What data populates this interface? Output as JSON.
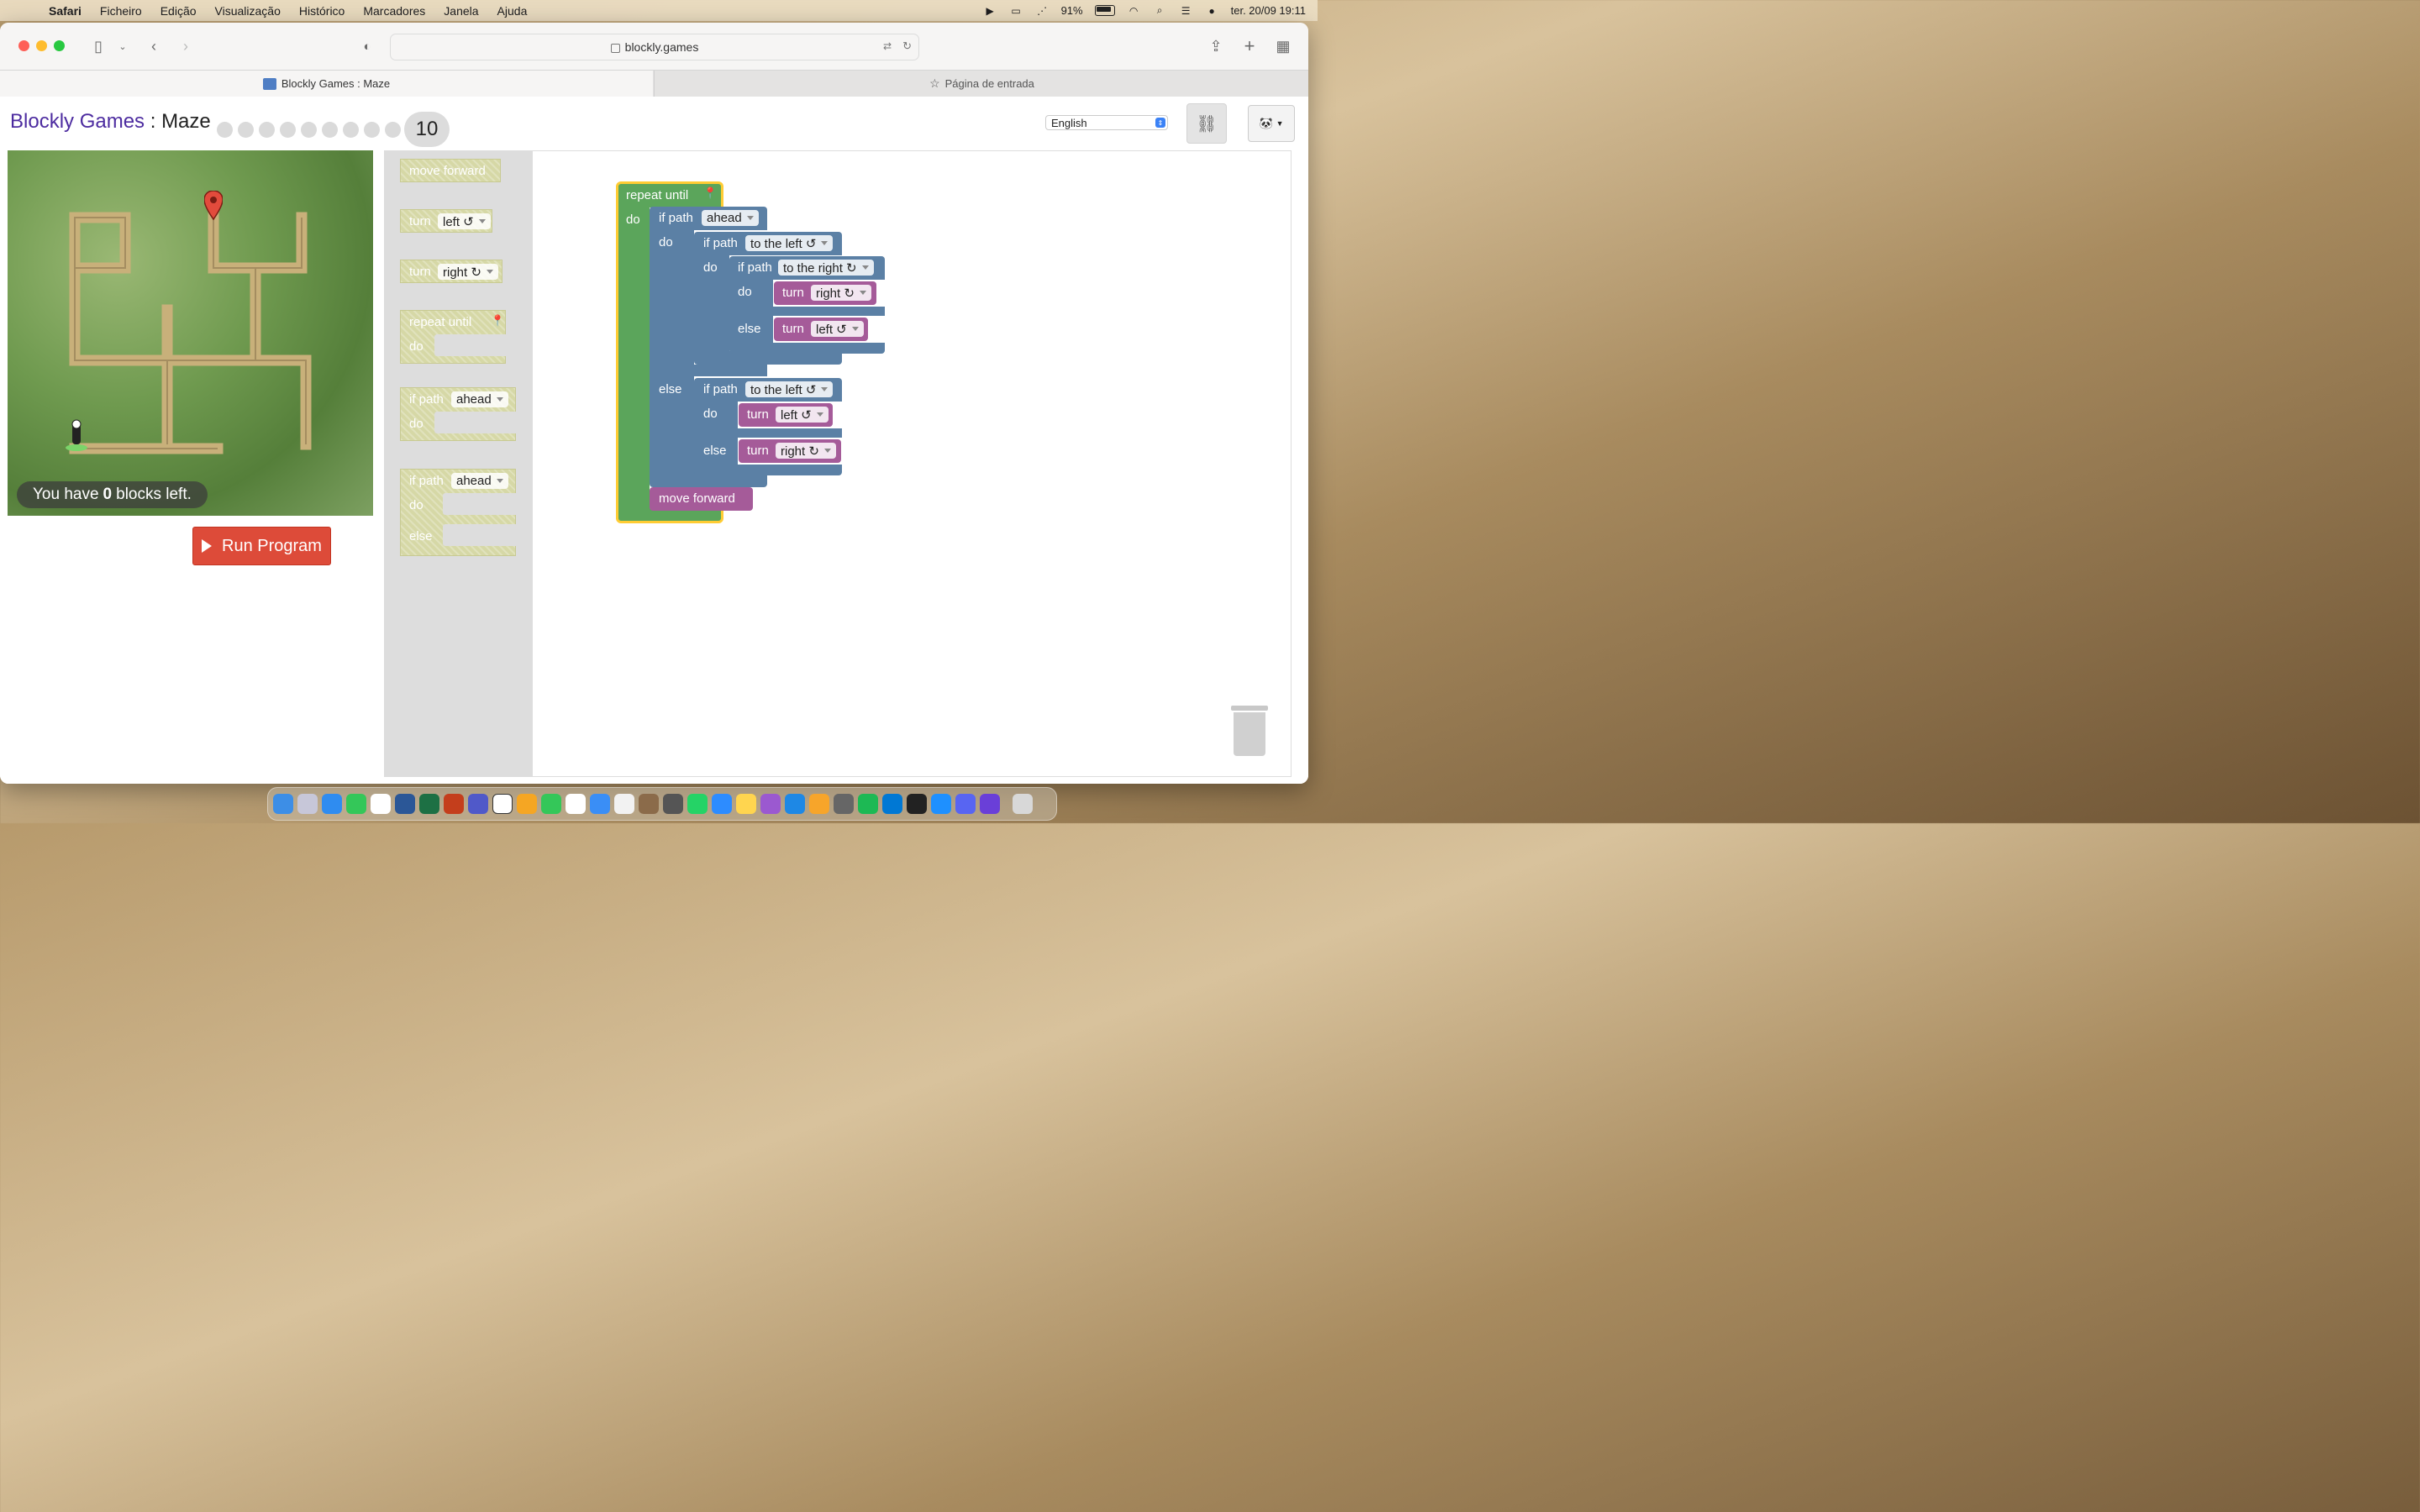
{
  "menubar": {
    "items": [
      "Safari",
      "Ficheiro",
      "Edição",
      "Visualização",
      "Histórico",
      "Marcadores",
      "Janela",
      "Ajuda"
    ],
    "battery": "91%",
    "datetime": "ter. 20/09  19:11"
  },
  "browser": {
    "url": "blockly.games",
    "tabs": [
      {
        "label": "Blockly Games : Maze",
        "active": true
      },
      {
        "label": "Página de entrada",
        "active": false
      }
    ]
  },
  "page": {
    "title_link": "Blockly Games",
    "title_sep": " : ",
    "title_game": "Maze",
    "level": "10",
    "language": "English",
    "blocks_left_prefix": "You have",
    "blocks_left_count": "0",
    "blocks_left_suffix": "blocks left.",
    "run_label": "Run Program"
  },
  "flyout": {
    "move_forward": "move forward",
    "turn": "turn",
    "left": "left ↺",
    "right": "right ↻",
    "repeat_until": "repeat until",
    "do": "do",
    "else": "else",
    "if_path": "if path",
    "ahead": "ahead"
  },
  "program": {
    "repeat_until": "repeat until",
    "do": "do",
    "else": "else",
    "if_path": "if path",
    "ahead": "ahead",
    "to_the_left": "to the left ↺",
    "to_the_right": "to the right ↻",
    "turn": "turn",
    "right": "right ↻",
    "left": "left ↺",
    "move_forward": "move forward"
  },
  "colors": {
    "loop": "#5ba55b",
    "logic": "#5b80a5",
    "movement": "#a55b99",
    "run": "#dd4b39",
    "title_link": "#4d2ca0"
  }
}
